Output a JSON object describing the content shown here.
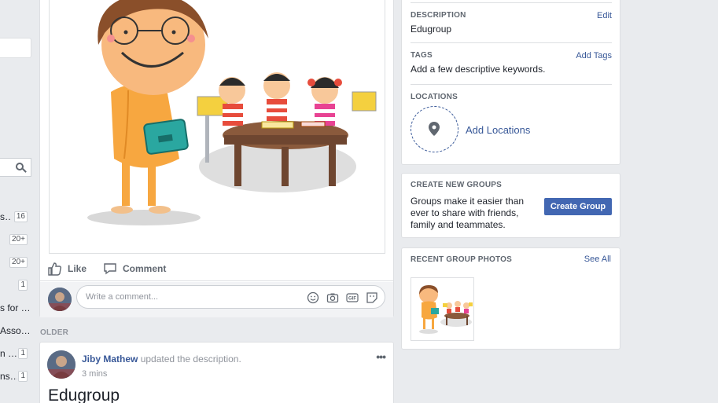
{
  "left_sidebar": {
    "items": [
      {
        "text": "s…",
        "count": "16"
      },
      {
        "text": "",
        "count": "20+"
      },
      {
        "text": "",
        "count": "20+"
      },
      {
        "text": "",
        "count": "1"
      },
      {
        "text": "s for …",
        "count": ""
      },
      {
        "text": "Asso…",
        "count": ""
      },
      {
        "text": "n …",
        "count": "1"
      },
      {
        "text": "ns…",
        "count": "1"
      }
    ]
  },
  "post": {
    "actions": {
      "like": "Like",
      "comment": "Comment"
    },
    "comment_placeholder": "Write a comment..."
  },
  "feed": {
    "older_label": "OLDER"
  },
  "story": {
    "author": "Jiby Mathew",
    "action": "updated the description.",
    "time": "3 mins",
    "title": "Edugroup"
  },
  "about": {
    "description": {
      "label": "DESCRIPTION",
      "link": "Edit",
      "value": "Edugroup"
    },
    "tags": {
      "label": "TAGS",
      "link": "Add Tags",
      "value": "Add a few descriptive keywords."
    },
    "locations": {
      "label": "LOCATIONS",
      "link": "Add Locations"
    }
  },
  "create_groups": {
    "label": "CREATE NEW GROUPS",
    "text": "Groups make it easier than ever to share with friends, family and teammates.",
    "button": "Create Group"
  },
  "recent_photos": {
    "label": "RECENT GROUP PHOTOS",
    "link": "See All"
  },
  "colors": {
    "link": "#385898",
    "button": "#4267b2",
    "background": "#e9ebee"
  }
}
